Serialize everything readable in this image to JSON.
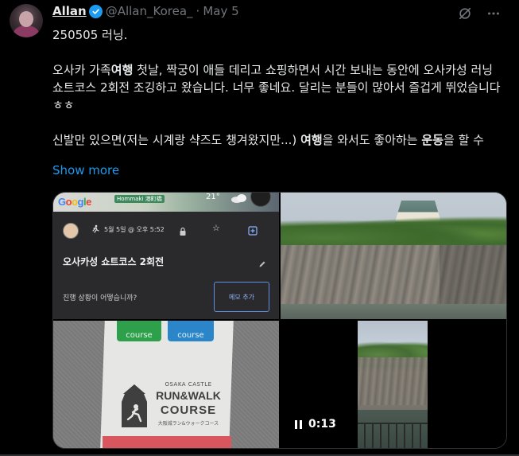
{
  "author": {
    "name": "Allan",
    "handle": "@Allan_Korea_",
    "separator": "·",
    "date": "May 5"
  },
  "icons": {
    "verified": "verified-badge-icon",
    "grok": "grok-icon",
    "more": "more-icon"
  },
  "tweet": {
    "line1": "250505 러닝.",
    "p2_a": "오사카 가족",
    "p2_b": "여행",
    "p2_c": " 첫날, 짝궁이 애들 데리고 쇼핑하면서 시간 보내는 동안에 오사카성 러닝 쇼트코스 2회전 조깅하고 왔습니다. 너무 좋네요. 달리는 분들이 많아서 즐겁게 뛰었습니다 ㅎㅎ",
    "p3_a": "신발만 있으면(저는 시계랑 샥즈도 챙겨왔지만...) ",
    "p3_b": "여행",
    "p3_c": "을 와서도 좋아하는 ",
    "p3_d": "운동",
    "p3_e": "을 할 수",
    "show_more": "Show more"
  },
  "media": {
    "map_app": {
      "logo_g1": "G",
      "logo_o1": "o",
      "logo_o2": "o",
      "logo_g2": "g",
      "logo_l": "l",
      "logo_e": "e",
      "map_badge": "Hommaki 港町橋",
      "weather": "21°",
      "date_time": "5월 5일 @ 오후 5:52",
      "title": "오사카성 쇼트코스 2회전",
      "question": "진행 상황이 어떻습니까?",
      "memo_button": "메모 추가"
    },
    "sign": {
      "green_tag": "course",
      "blue_tag": "course",
      "osaka": "OSAKA CASTLE",
      "runwalk": "RUN&WALK",
      "course": "COURSE",
      "jp": "大阪城ラン&ウォークコース"
    },
    "video": {
      "time": "0:13"
    }
  },
  "colors": {
    "background": "#000000",
    "text": "#e7e9ea",
    "muted": "#71767b",
    "accent": "#1d9bf0",
    "border": "#2f3336"
  }
}
